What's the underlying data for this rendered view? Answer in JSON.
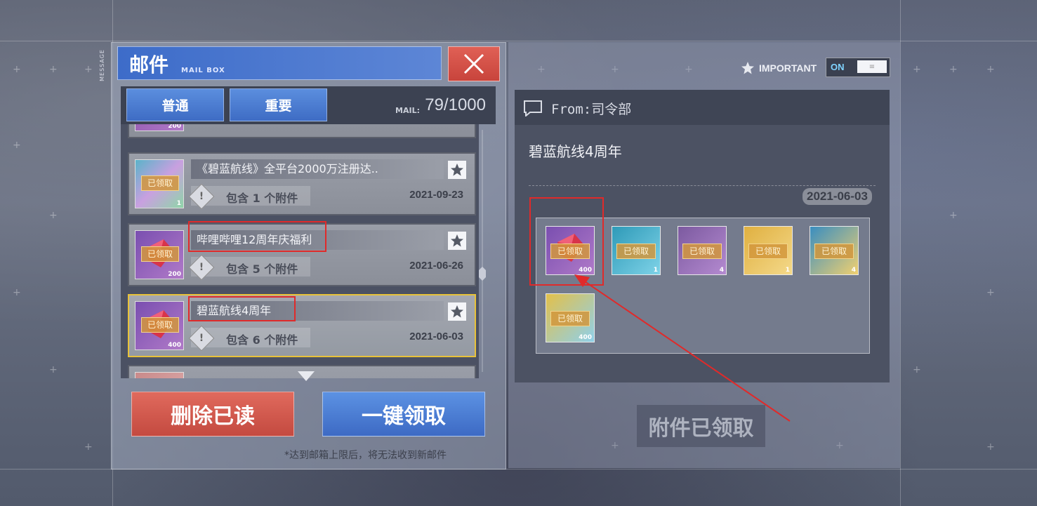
{
  "side_label": "MESSAGE",
  "header": {
    "title": "邮件",
    "subtitle": "MAIL BOX",
    "close_label": "×"
  },
  "tabs": [
    {
      "label": "普通"
    },
    {
      "label": "重要"
    }
  ],
  "mail_count": {
    "label": "MAIL:",
    "value": "79/1000"
  },
  "mails": [
    {
      "subject": "《碧蓝航线》全平台2000万注册达..",
      "attachments": "包含 1 个附件",
      "date": "2021-09-23",
      "tag": "已领取",
      "count": "1",
      "thumb_color": "#5bb3c9",
      "selected": false
    },
    {
      "subject": "哔哩哔哩12周年庆福利",
      "attachments": "包含 5 个附件",
      "date": "2021-06-26",
      "tag": "已领取",
      "count": "200",
      "thumb_color": "#8a4fa8",
      "selected": false
    },
    {
      "subject": "碧蓝航线4周年",
      "attachments": "包含 6 个附件",
      "date": "2021-06-03",
      "tag": "已领取",
      "count": "400",
      "thumb_color": "#8a4fa8",
      "selected": true
    }
  ],
  "partial_top_count": "200",
  "buttons": {
    "delete_read": "删除已读",
    "claim_all": "一键领取",
    "claimed": "附件已领取"
  },
  "footnote": "*达到邮箱上限后，将无法收到新邮件",
  "important": {
    "label": "IMPORTANT",
    "toggle_label": "ON",
    "toggle_knob": "≡"
  },
  "detail": {
    "from": "From:司令部",
    "body": "碧蓝航线4周年",
    "date": "2021-06-03",
    "items": [
      {
        "tag": "已领取",
        "count": "400",
        "color": "#7a4fb0"
      },
      {
        "tag": "已领取",
        "count": "1",
        "color": "#2e9ab8"
      },
      {
        "tag": "已领取",
        "count": "4",
        "color": "#7c5aa0"
      },
      {
        "tag": "已领取",
        "count": "1",
        "color": "#e0b040"
      },
      {
        "tag": "已领取",
        "count": "4",
        "color": "#3a8ec0"
      },
      {
        "tag": "已领取",
        "count": "400",
        "color": "#e3c04a"
      }
    ]
  },
  "colors": {
    "accent_blue": "#3d6cc9",
    "close_red": "#e06055",
    "highlight_red": "#e02a2a",
    "selected_border": "#e8c23a"
  }
}
